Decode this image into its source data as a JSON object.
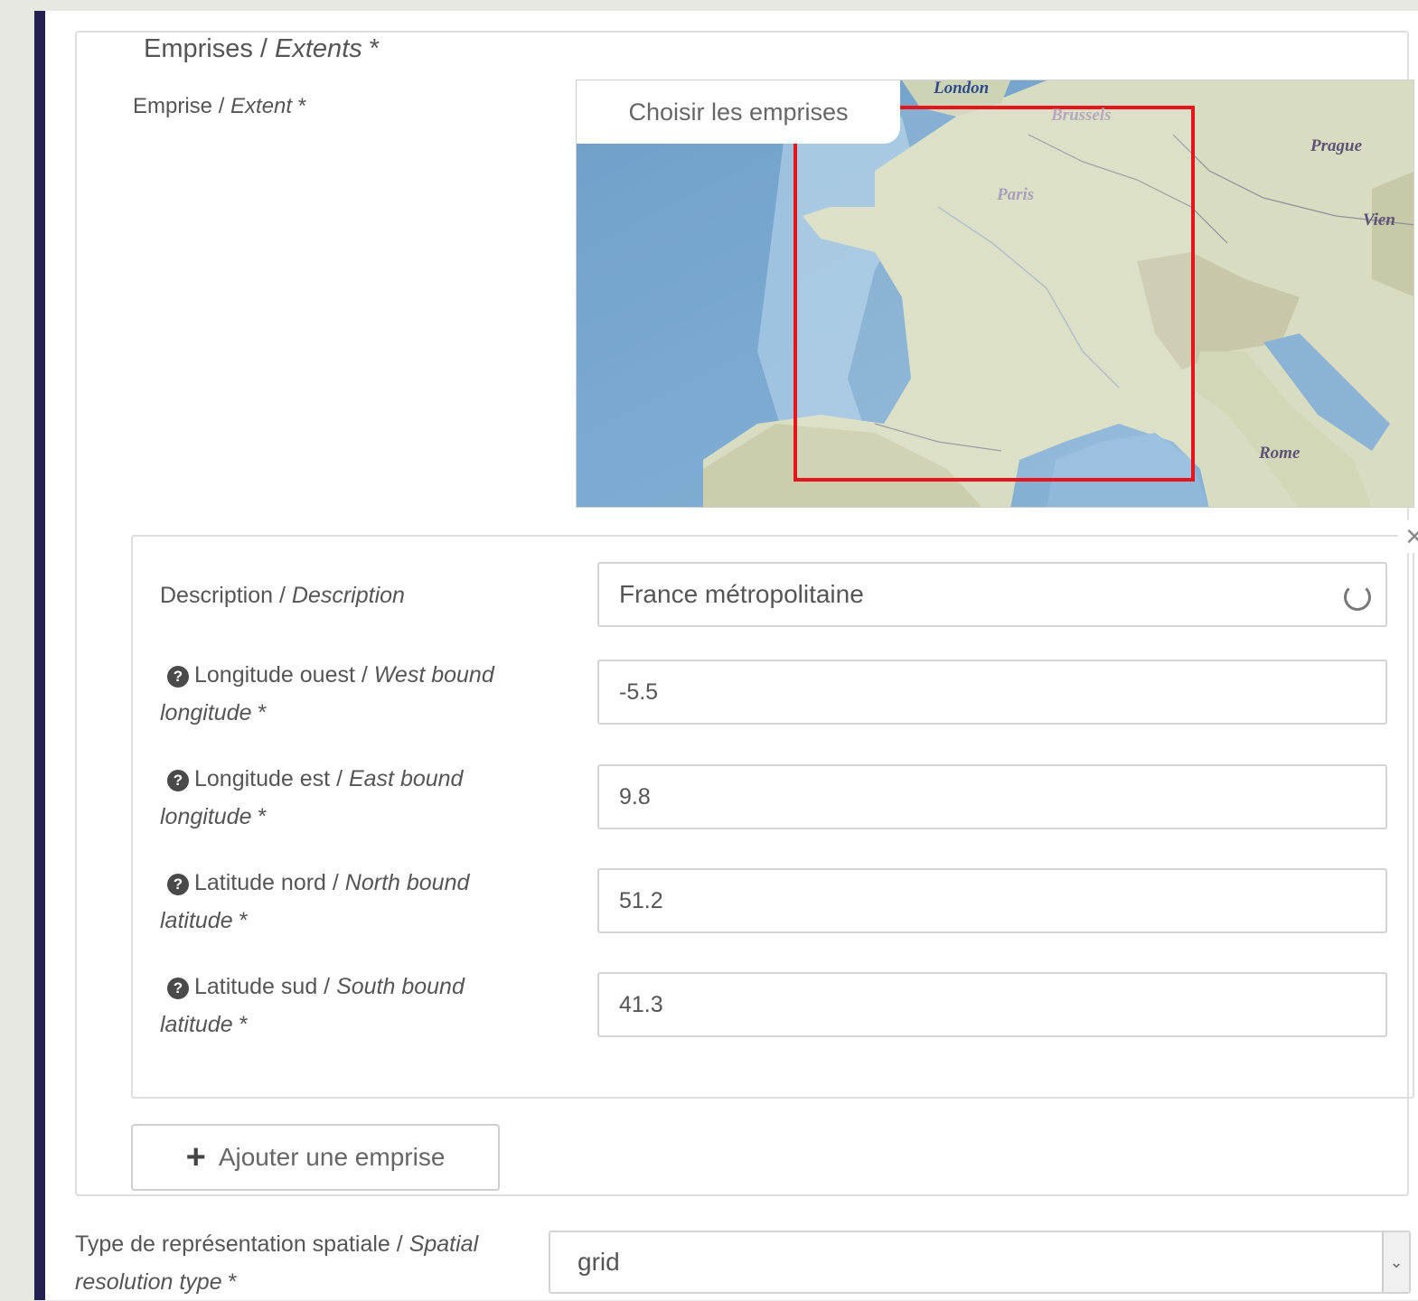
{
  "fieldset": {
    "legend_main": "Emprises / ",
    "legend_italic": "Extents",
    "legend_req": " *"
  },
  "extent_label": {
    "main": "Emprise / ",
    "italic": "Extent",
    "req": " *"
  },
  "map": {
    "button_label": "Choisir les emprises",
    "cities": {
      "london": "London",
      "brussels": "Brussels",
      "paris": "Paris",
      "prague": "Prague",
      "vienna": "Vien",
      "rome": "Rome"
    },
    "selection_color": "#e8141b"
  },
  "extent_item": {
    "description_label_main": "Description / ",
    "description_label_italic": "Description",
    "description_value": "France métropolitaine",
    "west_label_main": "Longitude ouest / ",
    "west_label_italic": "West bound longitude",
    "west_value": "-5.5",
    "east_label_main": "Longitude est / ",
    "east_label_italic": "East bound longitude",
    "east_value": "9.8",
    "north_label_main": "Latitude nord / ",
    "north_label_italic": "North bound latitude",
    "north_value": "51.2",
    "south_label_main": "Latitude sud / ",
    "south_label_italic": "South bound latitude",
    "south_value": "41.3",
    "required_mark": " *",
    "help_glyph": "?",
    "close_glyph": "×"
  },
  "add_button": {
    "icon": "plus-icon",
    "plus_glyph": "+",
    "label": "Ajouter une emprise"
  },
  "spatial": {
    "label_main": "Type de représentation spatiale / ",
    "label_italic": "Spatial resolution type",
    "req": " *",
    "value": "grid",
    "arrow_glyph": "⌄"
  },
  "colors": {
    "sidebar_accent": "#24204f"
  }
}
